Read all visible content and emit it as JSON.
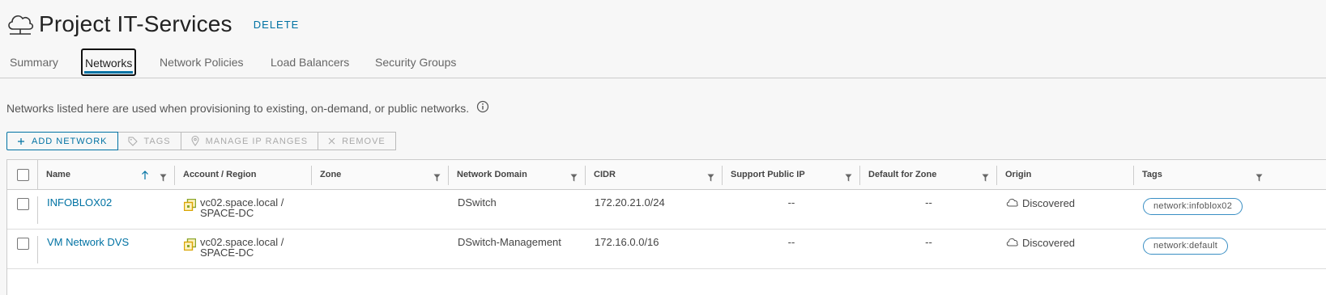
{
  "header": {
    "icon": "cloud-icon",
    "title": "Project IT-Services",
    "delete_label": "DELETE"
  },
  "tabs": [
    {
      "label": "Summary",
      "active": false
    },
    {
      "label": "Networks",
      "active": true
    },
    {
      "label": "Network Policies",
      "active": false
    },
    {
      "label": "Load Balancers",
      "active": false
    },
    {
      "label": "Security Groups",
      "active": false
    }
  ],
  "description": "Networks listed here are used when provisioning to existing, on-demand, or public networks.",
  "actions": {
    "add_network": "ADD NETWORK",
    "tags": "TAGS",
    "manage_ip_ranges": "MANAGE IP RANGES",
    "remove": "REMOVE"
  },
  "table": {
    "columns": [
      "Name",
      "Account / Region",
      "Zone",
      "Network Domain",
      "CIDR",
      "Support Public IP",
      "Default for Zone",
      "Origin",
      "Tags"
    ],
    "sort_column": "Name",
    "sort_direction": "ascending",
    "rows": [
      {
        "name": "INFOBLOX02",
        "account_line1": "vc02.space.local /",
        "account_line2": "SPACE-DC",
        "zone": "",
        "network_domain": "DSwitch",
        "cidr": "172.20.21.0/24",
        "support_public_ip": "--",
        "default_for_zone": "--",
        "origin": "Discovered",
        "tag": "network:infoblox02"
      },
      {
        "name": "VM Network DVS",
        "account_line1": "vc02.space.local /",
        "account_line2": "SPACE-DC",
        "zone": "",
        "network_domain": "DSwitch-Management",
        "cidr": "172.16.0.0/16",
        "support_public_ip": "--",
        "default_for_zone": "--",
        "origin": "Discovered",
        "tag": "network:default"
      }
    ]
  },
  "colors": {
    "accent": "#0072a3",
    "border": "#cccccc",
    "background": "#f7f7f7"
  }
}
